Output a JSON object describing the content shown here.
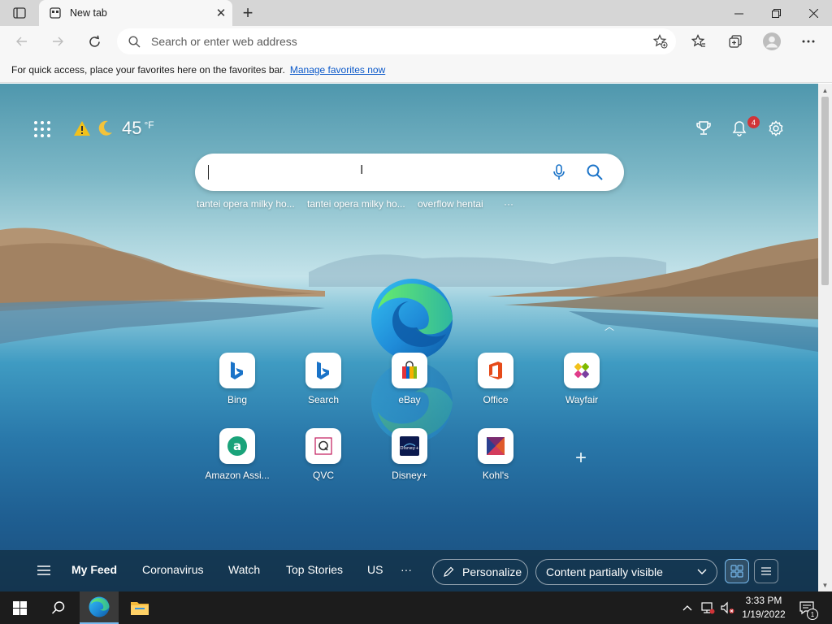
{
  "browser": {
    "tab_title": "New tab",
    "address_placeholder": "Search or enter web address",
    "favorites_message": "For quick access, place your favorites here on the favorites bar.",
    "favorites_link": "Manage favorites now"
  },
  "newtab": {
    "weather_temp": "45",
    "weather_unit": "°F",
    "notification_count": "4",
    "search_suggestions": [
      "tantei opera milky ho...",
      "tantei opera milky ho...",
      "overflow hentai"
    ],
    "suggestions_more": "···",
    "tiles": [
      {
        "label": "Bing",
        "icon": "bing-icon"
      },
      {
        "label": "Search",
        "icon": "bing-search-icon"
      },
      {
        "label": "eBay",
        "icon": "ebay-bag-icon"
      },
      {
        "label": "Office",
        "icon": "office-icon"
      },
      {
        "label": "Wayfair",
        "icon": "wayfair-icon"
      },
      {
        "label": "Amazon Assi...",
        "icon": "amazon-assistant-icon"
      },
      {
        "label": "QVC",
        "icon": "qvc-icon"
      },
      {
        "label": "Disney+",
        "icon": "disney-plus-icon"
      },
      {
        "label": "Kohl's",
        "icon": "kohls-icon"
      }
    ]
  },
  "feed": {
    "items": [
      "My Feed",
      "Coronavirus",
      "Watch",
      "Top Stories",
      "US"
    ],
    "more": "···",
    "personalize": "Personalize",
    "content_visibility": "Content partially visible"
  },
  "taskbar": {
    "time": "3:33 PM",
    "date": "1/19/2022",
    "action_center_count": "1"
  },
  "colors": {
    "accent": "#0a58c9",
    "badge": "#d13438",
    "taskbar": "#1c1c1c"
  }
}
